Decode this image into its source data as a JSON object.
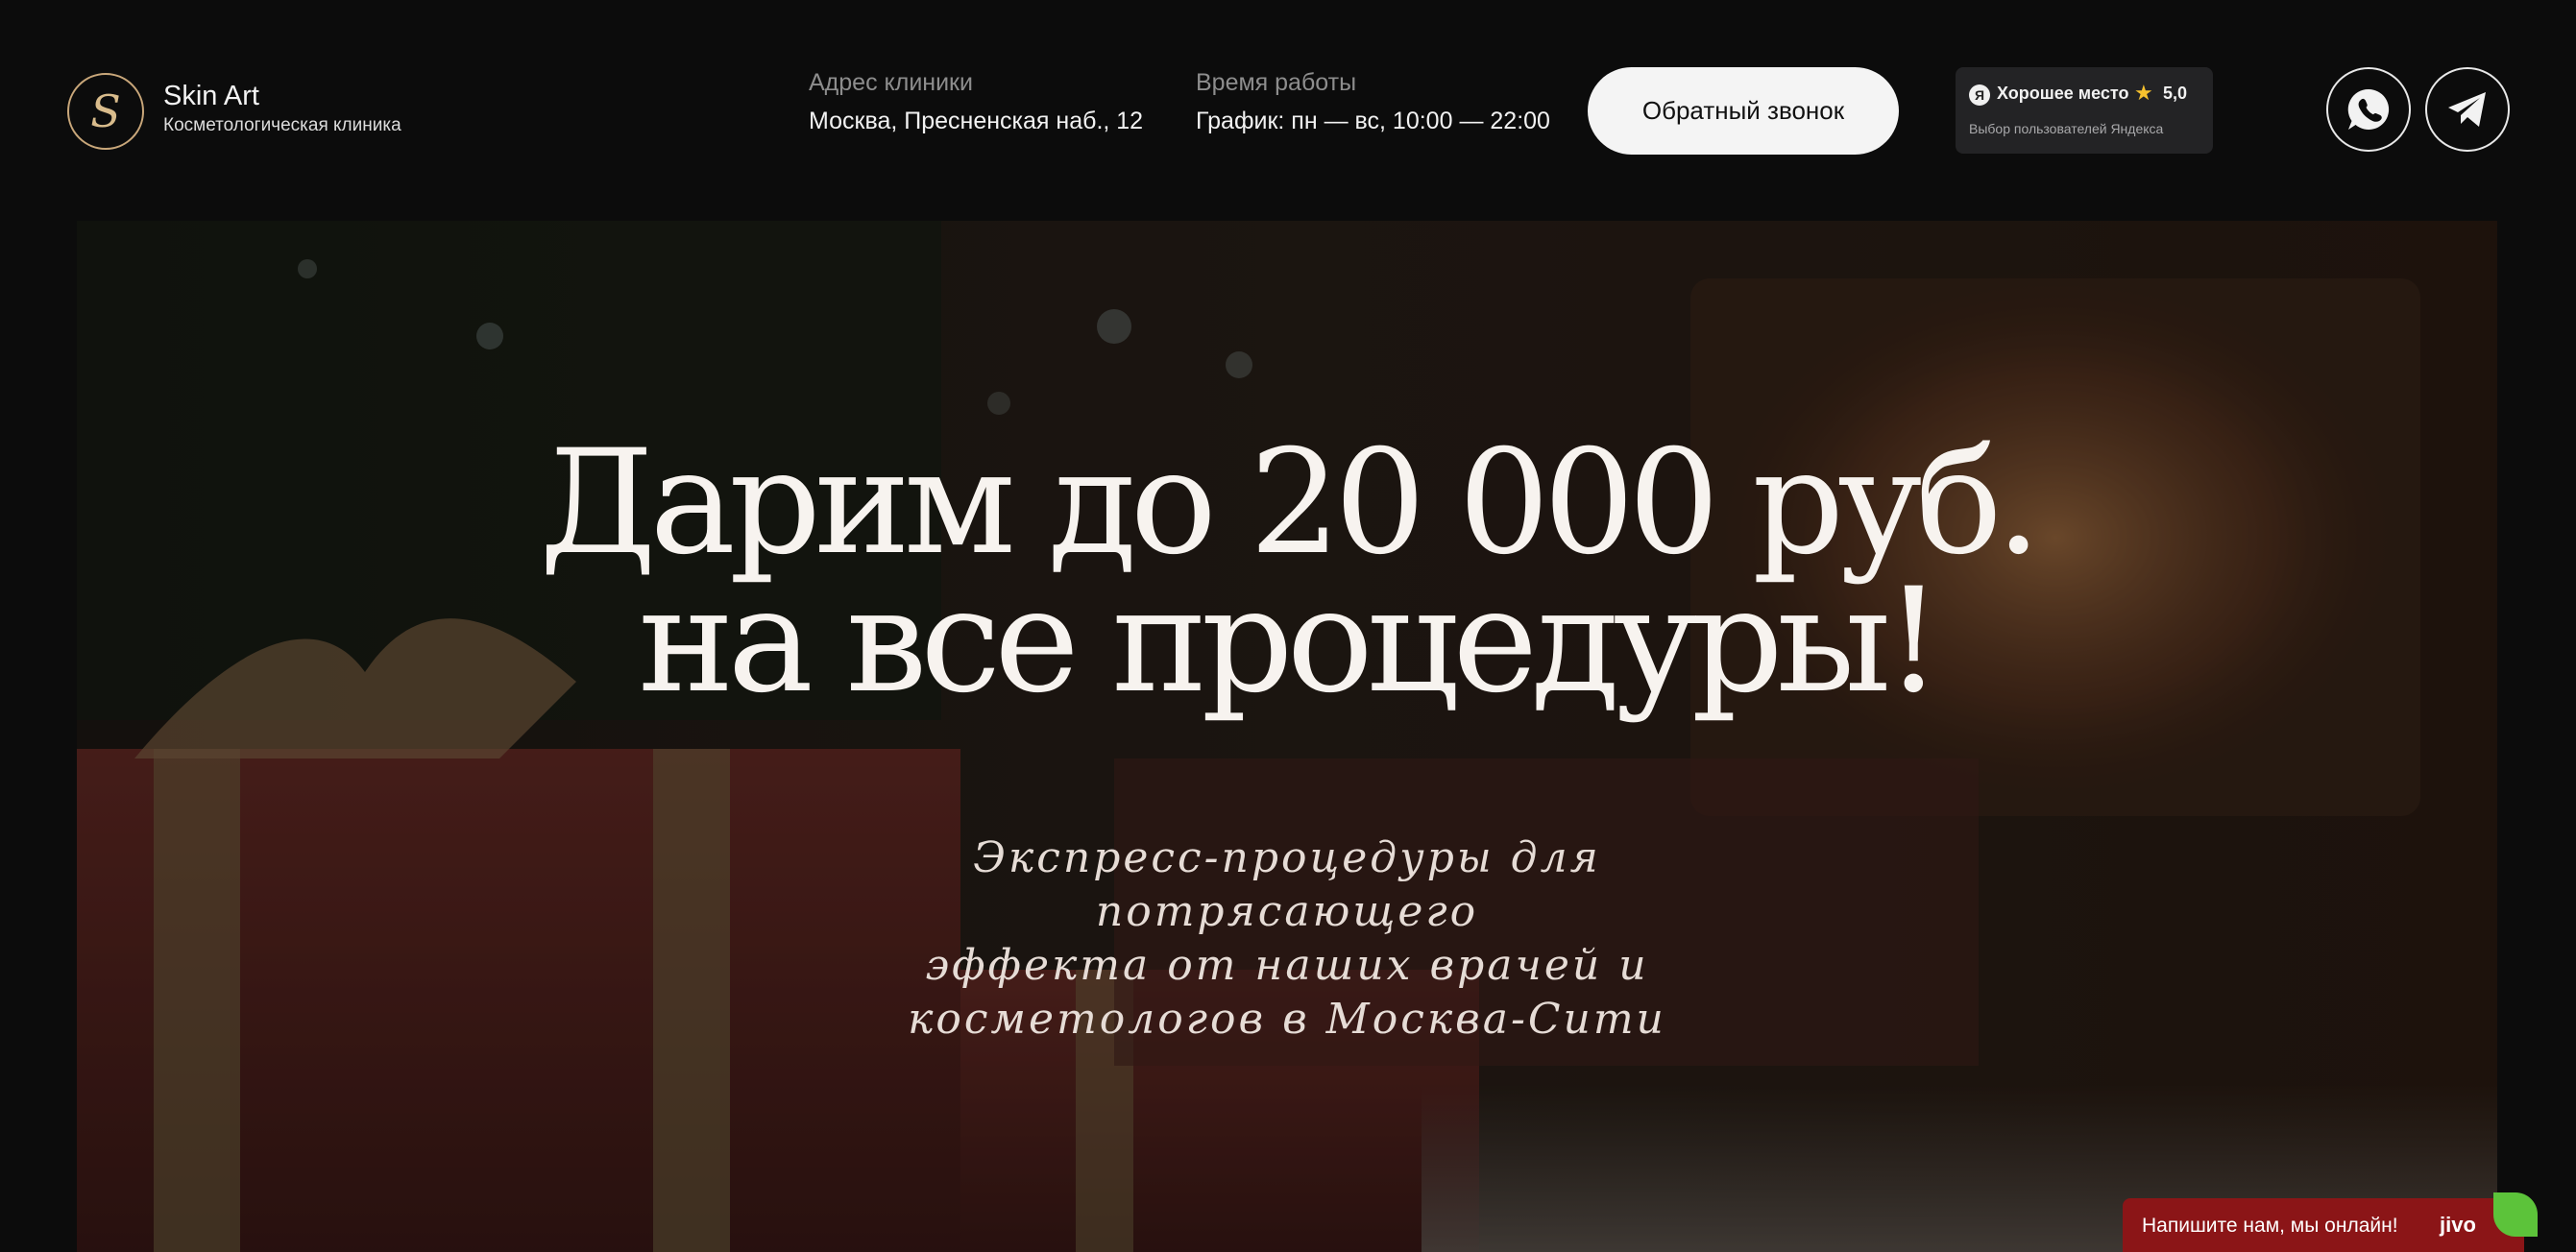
{
  "header": {
    "brand": {
      "name": "Skin Art",
      "subtitle": "Косметологическая клиника"
    },
    "address": {
      "label": "Адрес клиники",
      "value": "Москва, Пресненская наб., 12"
    },
    "hours": {
      "label": "Время работы",
      "value": "График: пн — вс, 10:00 — 22:00"
    },
    "callback_button": "Обратный звонок",
    "rating_badge": {
      "logo_letter": "Я",
      "title": "Хорошее место",
      "rating": "5,0",
      "subtitle": "Выбор пользователей Яндекса"
    },
    "social": [
      "whatsapp-icon",
      "telegram-icon"
    ]
  },
  "hero": {
    "title_line1": "Дарим до 20 000 руб.",
    "title_line2": "на все процедуры!",
    "subtitle_line1": "Экспресс-процедуры для потрясающего",
    "subtitle_line2": "эффекта от наших врачей и",
    "subtitle_line3": "косметологов в Москва-Сити"
  },
  "chat": {
    "text": "Напишите нам, мы онлайн!",
    "brand": "jivo"
  },
  "colors": {
    "page_bg": "#0c0c0c",
    "button_bg": "#f4f4f4",
    "chat_bg": "#8b1517",
    "accent_gold": "#c9a77a",
    "star": "#f6c12e"
  }
}
